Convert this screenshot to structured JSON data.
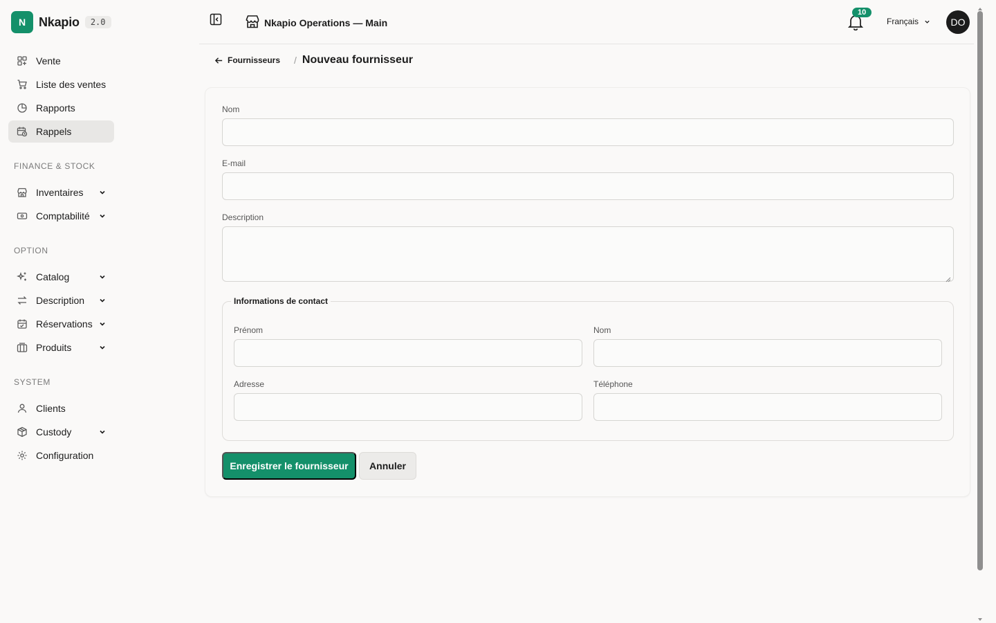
{
  "brand": {
    "logo_letter": "N",
    "name": "Nkapio",
    "version": "2.0",
    "accent": "#14906a"
  },
  "sidebar": {
    "main_items": [
      {
        "label": "Vente",
        "icon": "grid-plus-icon"
      },
      {
        "label": "Liste des ventes",
        "icon": "cart-icon"
      },
      {
        "label": "Rapports",
        "icon": "pie-chart-icon"
      },
      {
        "label": "Rappels",
        "icon": "calendar-clock-icon",
        "active": true
      }
    ],
    "sections": [
      {
        "title": "FINANCE & STOCK",
        "items": [
          {
            "label": "Inventaires",
            "icon": "store-icon",
            "expandable": true
          },
          {
            "label": "Comptabilité",
            "icon": "banknote-icon",
            "expandable": true
          }
        ]
      },
      {
        "title": "OPTION",
        "items": [
          {
            "label": "Catalog",
            "icon": "sparkles-icon",
            "expandable": true
          },
          {
            "label": "Description",
            "icon": "arrows-swap-icon",
            "expandable": true
          },
          {
            "label": "Réservations",
            "icon": "calendar-check-icon",
            "expandable": true
          },
          {
            "label": "Produits",
            "icon": "boxes-icon",
            "expandable": true
          }
        ]
      },
      {
        "title": "SYSTEM",
        "items": [
          {
            "label": "Clients",
            "icon": "user-icon",
            "expandable": false
          },
          {
            "label": "Custody",
            "icon": "package-icon",
            "expandable": true
          },
          {
            "label": "Configuration",
            "icon": "gear-icon",
            "expandable": false
          }
        ]
      }
    ]
  },
  "header": {
    "store_title": "Nkapio Operations — Main",
    "notifications_count": "10",
    "language": "Français",
    "avatar_initials": "DO"
  },
  "breadcrumb": {
    "back_label": "Fournisseurs",
    "separator": "/",
    "current": "Nouveau fournisseur"
  },
  "form": {
    "name_label": "Nom",
    "name_value": "",
    "email_label": "E-mail",
    "email_value": "",
    "description_label": "Description",
    "description_value": "",
    "contact": {
      "legend": "Informations de contact",
      "first_name_label": "Prénom",
      "last_name_label": "Nom",
      "address_label": "Adresse",
      "phone_label": "Téléphone"
    },
    "save_label": "Enregistrer le fournisseur",
    "cancel_label": "Annuler"
  }
}
